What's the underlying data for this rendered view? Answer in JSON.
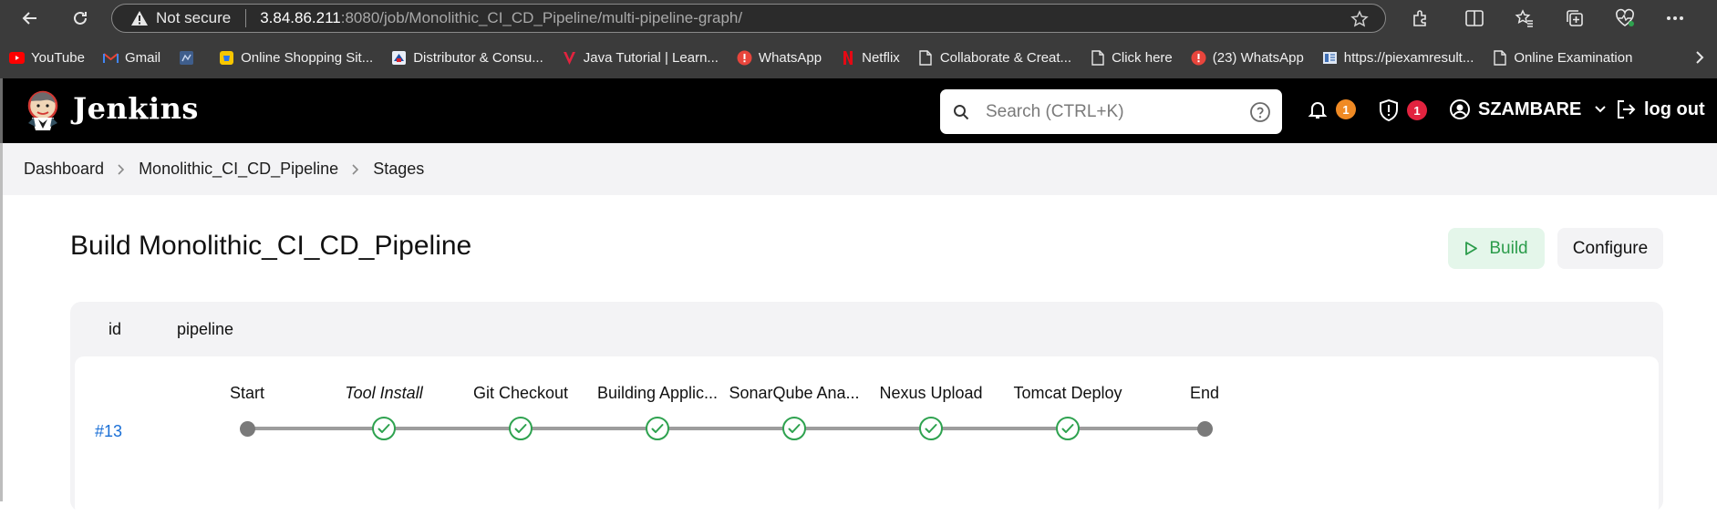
{
  "browser": {
    "address": {
      "not_secure": "Not secure",
      "host": "3.84.86.211",
      "path": ":8080/job/Monolithic_CI_CD_Pipeline/multi-pipeline-graph/"
    },
    "bookmarks": [
      {
        "label": "YouTube",
        "icon": "youtube-icon"
      },
      {
        "label": "Gmail",
        "icon": "gmail-icon"
      },
      {
        "label": "",
        "icon": "site-icon"
      },
      {
        "label": "Online Shopping Sit...",
        "icon": "shopping-icon"
      },
      {
        "label": "Distributor & Consu...",
        "icon": "distributor-icon"
      },
      {
        "label": "Java Tutorial | Learn...",
        "icon": "java-icon"
      },
      {
        "label": "WhatsApp",
        "icon": "whatsapp-icon"
      },
      {
        "label": "Netflix",
        "icon": "netflix-icon"
      },
      {
        "label": "Collaborate & Creat...",
        "icon": "page-icon"
      },
      {
        "label": "Click here",
        "icon": "page-icon"
      },
      {
        "label": "(23) WhatsApp",
        "icon": "whatsapp-icon"
      },
      {
        "label": "https://piexamresult...",
        "icon": "doc-icon"
      },
      {
        "label": "Online Examination",
        "icon": "page-icon"
      }
    ]
  },
  "header": {
    "brand": "Jenkins",
    "search_placeholder": "Search (CTRL+K)",
    "notifications_count": "1",
    "security_count": "1",
    "user": "SZAMBARE",
    "logout": "log out"
  },
  "breadcrumb": [
    "Dashboard",
    "Monolithic_CI_CD_Pipeline",
    "Stages"
  ],
  "main": {
    "title": "Build Monolithic_CI_CD_Pipeline",
    "build_button": "Build",
    "configure_button": "Configure",
    "col_id": "id",
    "col_pipeline": "pipeline",
    "run": {
      "id": "#13",
      "stages": [
        {
          "label": "Start",
          "status": "start"
        },
        {
          "label": "Tool Install",
          "status": "success",
          "italic": true
        },
        {
          "label": "Git Checkout",
          "status": "success"
        },
        {
          "label": "Building Applic...",
          "status": "success"
        },
        {
          "label": "SonarQube Ana...",
          "status": "success"
        },
        {
          "label": "Nexus Upload",
          "status": "success"
        },
        {
          "label": "Tomcat Deploy",
          "status": "success"
        },
        {
          "label": "End",
          "status": "end"
        }
      ]
    }
  },
  "colors": {
    "success": "#2ea24f",
    "link": "#1a6fd6",
    "badge_orange": "#f08a24",
    "badge_red": "#e2233f"
  }
}
